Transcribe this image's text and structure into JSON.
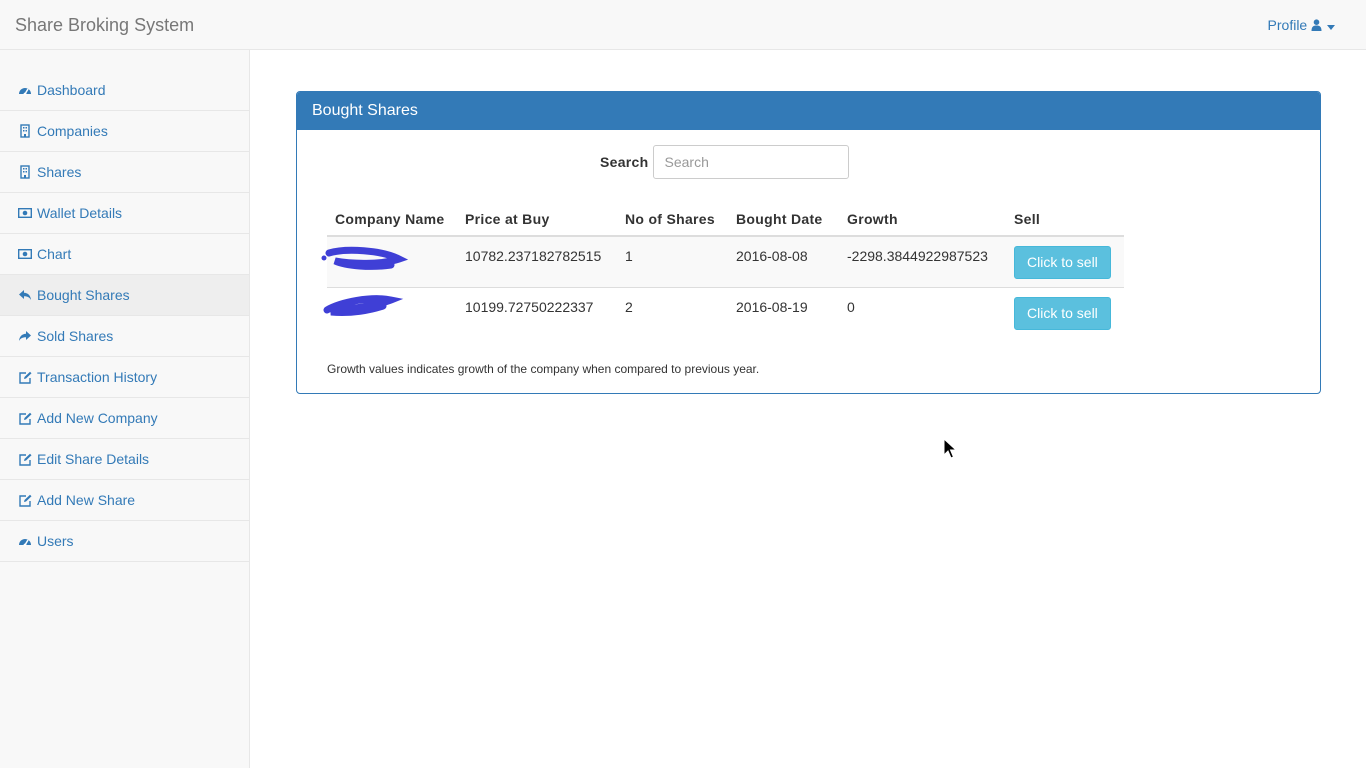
{
  "app": {
    "title": "Share Broking System"
  },
  "header": {
    "profile_label": "Profile"
  },
  "sidebar": {
    "items": [
      {
        "label": "Dashboard",
        "icon": "dashboard-icon"
      },
      {
        "label": "Companies",
        "icon": "building-icon"
      },
      {
        "label": "Shares",
        "icon": "building-icon"
      },
      {
        "label": "Wallet Details",
        "icon": "money-icon"
      },
      {
        "label": "Chart",
        "icon": "money-icon"
      },
      {
        "label": "Bought Shares",
        "icon": "reply-icon",
        "active": true
      },
      {
        "label": "Sold Shares",
        "icon": "share-icon"
      },
      {
        "label": "Transaction History",
        "icon": "edit-icon"
      },
      {
        "label": "Add New Company",
        "icon": "edit-icon"
      },
      {
        "label": "Edit Share Details",
        "icon": "edit-icon"
      },
      {
        "label": "Add New Share",
        "icon": "edit-icon"
      },
      {
        "label": "Users",
        "icon": "dashboard-icon"
      }
    ]
  },
  "panel": {
    "title": "Bought Shares",
    "search_label": "Search",
    "search_placeholder": "Search",
    "search_value": "",
    "columns": [
      "Company Name",
      "Price at Buy",
      "No of Shares",
      "Bought Date",
      "Growth",
      "Sell"
    ],
    "rows": [
      {
        "company": "",
        "price": "10782.237182782515",
        "shares": "1",
        "date": "2016-08-08",
        "growth": "-2298.3844922987523",
        "sell_label": "Click to sell"
      },
      {
        "company": "",
        "price": "10199.72750222337",
        "shares": "2",
        "date": "2016-08-19",
        "growth": "0",
        "sell_label": "Click to sell"
      }
    ],
    "note": "Growth values indicates growth of the company when compared to previous year."
  },
  "colors": {
    "primary": "#337ab7",
    "info_button": "#5bc0de",
    "redaction": "#3f3fd6"
  }
}
